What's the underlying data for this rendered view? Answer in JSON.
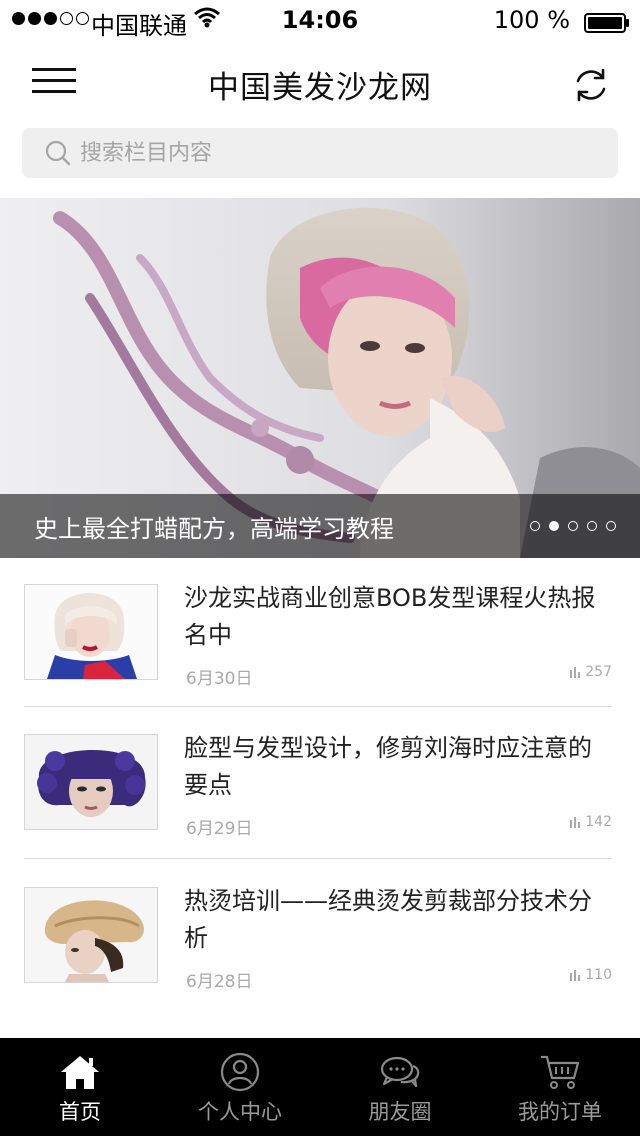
{
  "status_bar": {
    "carrier": "中国联通",
    "time": "14:06",
    "battery": "100 %"
  },
  "header": {
    "title": "中国美发沙龙网",
    "menu_icon": "hamburger-menu-icon",
    "refresh_icon": "refresh-icon"
  },
  "search": {
    "placeholder": "搜索栏目内容",
    "value": "",
    "icon": "search-icon"
  },
  "banner": {
    "caption": "史上最全打蜡配方，高端学习教程",
    "slide_count": 5,
    "active_slide": 2
  },
  "articles": [
    {
      "title": "沙龙实战商业创意BOB发型课程火热报名中",
      "date": "6月30日",
      "views": "257"
    },
    {
      "title": "脸型与发型设计，修剪刘海时应注意的要点",
      "date": "6月29日",
      "views": "142"
    },
    {
      "title": "热烫培训——经典烫发剪裁部分技术分析",
      "date": "6月28日",
      "views": "110"
    }
  ],
  "tabs": [
    {
      "label": "首页",
      "icon": "home-icon",
      "active": true
    },
    {
      "label": "个人中心",
      "icon": "user-icon",
      "active": false
    },
    {
      "label": "朋友圈",
      "icon": "chat-bubbles-icon",
      "active": false
    },
    {
      "label": "我的订单",
      "icon": "shopping-cart-icon",
      "active": false
    }
  ],
  "colors": {
    "tab_bar_bg": "#000000",
    "tab_active": "#ffffff",
    "tab_inactive": "#9a9a9a",
    "search_bg": "#efefef"
  }
}
